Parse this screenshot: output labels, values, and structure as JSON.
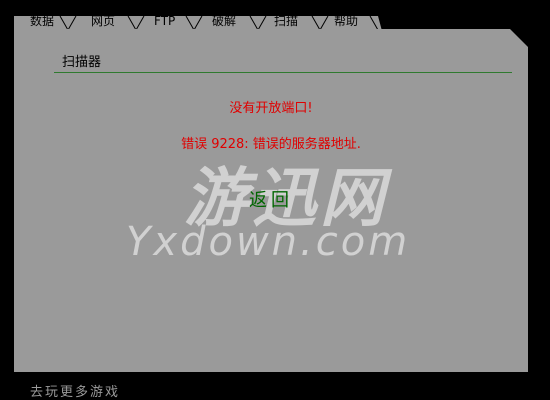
{
  "tabs": [
    {
      "label": "数据"
    },
    {
      "label": "网页"
    },
    {
      "label": "FTP"
    },
    {
      "label": "破解"
    },
    {
      "label": "扫描"
    },
    {
      "label": "帮助"
    }
  ],
  "panel": {
    "section_title": "扫描器",
    "message_1": "没有开放端口!",
    "message_2": "错误 9228: 错误的服务器地址.",
    "back_label": "返回"
  },
  "watermark": {
    "logo": "游迅网",
    "text": "Yxdown.com"
  },
  "footer": {
    "link": "去玩更多游戏"
  },
  "colors": {
    "background": "#000000",
    "panel": "#9a9a9a",
    "error": "#e00000",
    "link_green": "#006600",
    "rule_green": "#2f7a2f"
  }
}
